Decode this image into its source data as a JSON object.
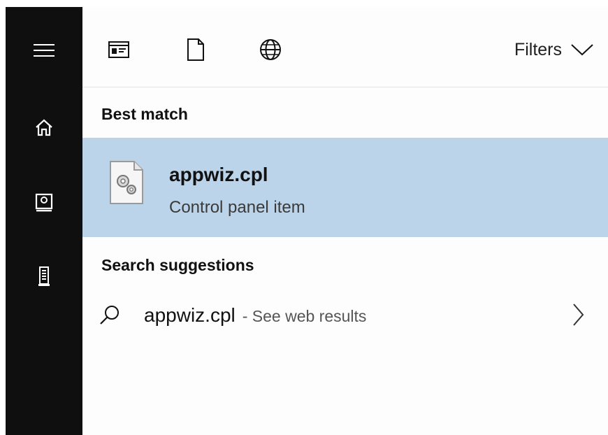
{
  "sidebar": {
    "items": [
      {
        "icon": "hamburger-menu-icon"
      },
      {
        "icon": "home-icon"
      },
      {
        "icon": "notebook-icon"
      },
      {
        "icon": "device-tower-icon"
      }
    ]
  },
  "toolbar": {
    "tabs": [
      {
        "icon": "apps-icon"
      },
      {
        "icon": "document-icon"
      },
      {
        "icon": "web-globe-icon"
      }
    ],
    "filters_label": "Filters"
  },
  "best_match": {
    "heading": "Best match",
    "name": "appwiz.cpl",
    "type": "Control panel item",
    "icon": "settings-file-icon",
    "highlight_color": "#bcd4ea"
  },
  "suggestions": {
    "heading": "Search suggestions",
    "items": [
      {
        "term": "appwiz.cpl",
        "extra": "- See web results",
        "icon": "search-icon"
      }
    ]
  },
  "colors": {
    "sidebar": "#0f0f0f",
    "accent": "#bcd4ea"
  }
}
